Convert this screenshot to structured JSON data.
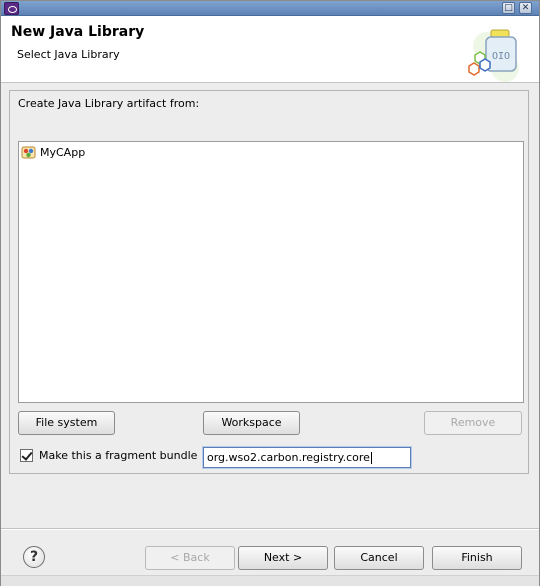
{
  "window": {
    "title_icon": "eclipse-icon",
    "maximize_glyph": "□",
    "close_glyph": "✕"
  },
  "header": {
    "title": "New Java Library",
    "subtitle": "Select Java Library",
    "banner_icon": "java-library-jar-icon"
  },
  "group": {
    "label": "Create Java Library artifact from:",
    "items": [
      {
        "label": "MyCApp",
        "icon": "capp-project-icon"
      }
    ]
  },
  "buttons": {
    "file_system": "File system",
    "workspace": "Workspace",
    "remove": "Remove"
  },
  "fragment": {
    "checkbox_label": "Make this a fragment bundle",
    "checked": true,
    "bundle_value": "org.wso2.carbon.registry.core"
  },
  "footer": {
    "help_glyph": "?",
    "back": "< Back",
    "next": "Next >",
    "cancel": "Cancel",
    "finish": "Finish"
  },
  "colors": {
    "titlebar": "#6a8fc2",
    "dialog_bg": "#ededed",
    "input_focus": "#5a7fb8"
  }
}
